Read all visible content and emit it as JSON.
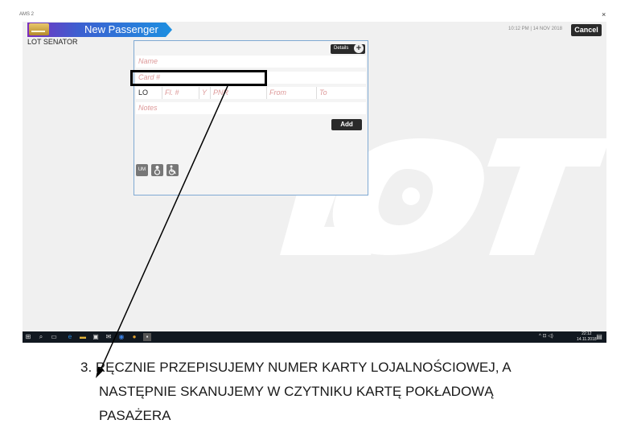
{
  "window": {
    "title": "AMS 2",
    "close_glyph": "×"
  },
  "app": {
    "title": "New Passenger",
    "subtitle": "LOT SENATOR",
    "clock": "10:12 PM | 14 NOV 2018",
    "cancel_label": "Cancel",
    "watermark_brand": "LOT"
  },
  "form": {
    "details_label": "Details",
    "details_plus": "+",
    "name_placeholder": "Name",
    "card_placeholder": "Card #",
    "airline_value": "LO",
    "flight_placeholder": "Fl. #",
    "class_placeholder": "Y",
    "pnr_placeholder": "PNR",
    "from_placeholder": "From",
    "to_placeholder": "To",
    "notes_placeholder": "Notes",
    "add_label": "Add",
    "ssr_icons": [
      {
        "name": "unaccompanied-minor-icon",
        "label": "UM"
      },
      {
        "name": "infant-icon",
        "label": "♿"
      },
      {
        "name": "wheelchair-icon",
        "label": "♿"
      }
    ]
  },
  "taskbar": {
    "tray_text": "^ ⊡ ◁)",
    "time": "22:12",
    "date": "14.11.2018"
  },
  "caption": {
    "line1": "3. RĘCZNIE PRZEPISUJEMY NUMER KARTY LOJALNOŚCIOWEJ, A",
    "line2": "NASTĘPNIE SKANUJEMY W CZYTNIKU KARTĘ POKŁADOWĄ",
    "line3": "PASAŻERA"
  },
  "colors": {
    "header_purple": "#7b2fbf",
    "header_blue": "#1d8fe0",
    "panel_border": "#7fa9d3",
    "placeholder": "#dd9999",
    "dark_button": "#2a2a2a"
  }
}
